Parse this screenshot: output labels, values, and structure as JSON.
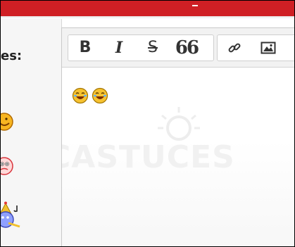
{
  "sidebar": {
    "label": "es:",
    "smilies": [
      {
        "name": "smiling-face-icon"
      },
      {
        "name": "confused-face-icon"
      },
      {
        "name": "party-face-icon"
      }
    ]
  },
  "toolbar": {
    "bold": "B",
    "italic": "I",
    "strike": "S",
    "quote": "66"
  },
  "editor": {
    "content_emojis": [
      "laughing-face-icon",
      "laughing-face-icon"
    ],
    "watermark": "CASTUCES"
  },
  "colors": {
    "brand_red": "#cf1f24",
    "toolbar_bg": "#f2f2f2"
  }
}
